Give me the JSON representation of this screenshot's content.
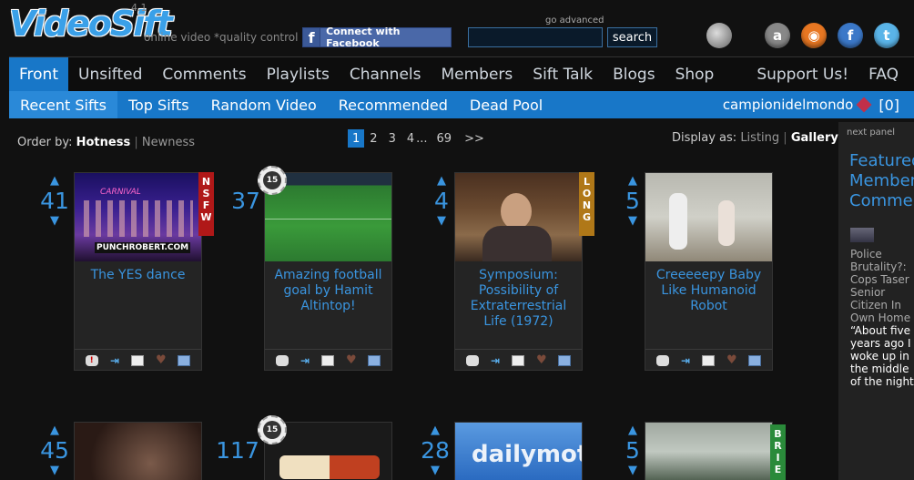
{
  "header": {
    "logo": "VideoSift",
    "version": "4.1",
    "tagline": "online video *quality control",
    "facebook_button": "Connect with Facebook",
    "advanced_search": "go advanced",
    "search_button": "search",
    "search_value": ""
  },
  "main_nav": [
    "Front",
    "Unsifted",
    "Comments",
    "Playlists",
    "Channels",
    "Members",
    "Sift Talk",
    "Blogs",
    "Shop"
  ],
  "main_nav_right": [
    "Support Us!",
    "FAQ"
  ],
  "sub_nav": [
    "Recent Sifts",
    "Top Sifts",
    "Random Video",
    "Recommended",
    "Dead Pool"
  ],
  "user": {
    "name": "campionidelmondo",
    "count": "[0]"
  },
  "order_by": {
    "label": "Order by:",
    "selected": "Hotness",
    "other": "Newness"
  },
  "pager": {
    "pages": [
      "1",
      "2",
      "3",
      "4"
    ],
    "ellipsis": "...",
    "last": "69",
    "next": ">>"
  },
  "display_as": {
    "label": "Display as:",
    "other": "Listing",
    "selected": "Gallery"
  },
  "cards": [
    {
      "votes": "41",
      "title": "The YES dance",
      "badge": "NSFW",
      "thumb_text": "PUNCHROBERT.COM",
      "thumb_overlay": "CARNIVAL"
    },
    {
      "votes": "37",
      "title": "Amazing football goal by Hamit Altintop!",
      "seal": "15"
    },
    {
      "votes": "4",
      "title": "Symposium: Possibility of Extraterrestrial Life (1972)",
      "badge": "LONG"
    },
    {
      "votes": "5",
      "title": "Creeeeepy Baby Like Humanoid Robot"
    },
    {
      "votes": "45"
    },
    {
      "votes": "117",
      "seal": "15"
    },
    {
      "votes": "28",
      "thumb_text": "dailymotion"
    },
    {
      "votes": "5",
      "badge": "BRIE"
    }
  ],
  "right_panel": {
    "next_panel": "next panel",
    "featured": [
      "Featured",
      "Members",
      "Comments"
    ],
    "headline": "Police Brutality?: Cops Taser Senior Citizen In Own Home",
    "quote": "“About five years ago I woke up in the middle of the night"
  }
}
